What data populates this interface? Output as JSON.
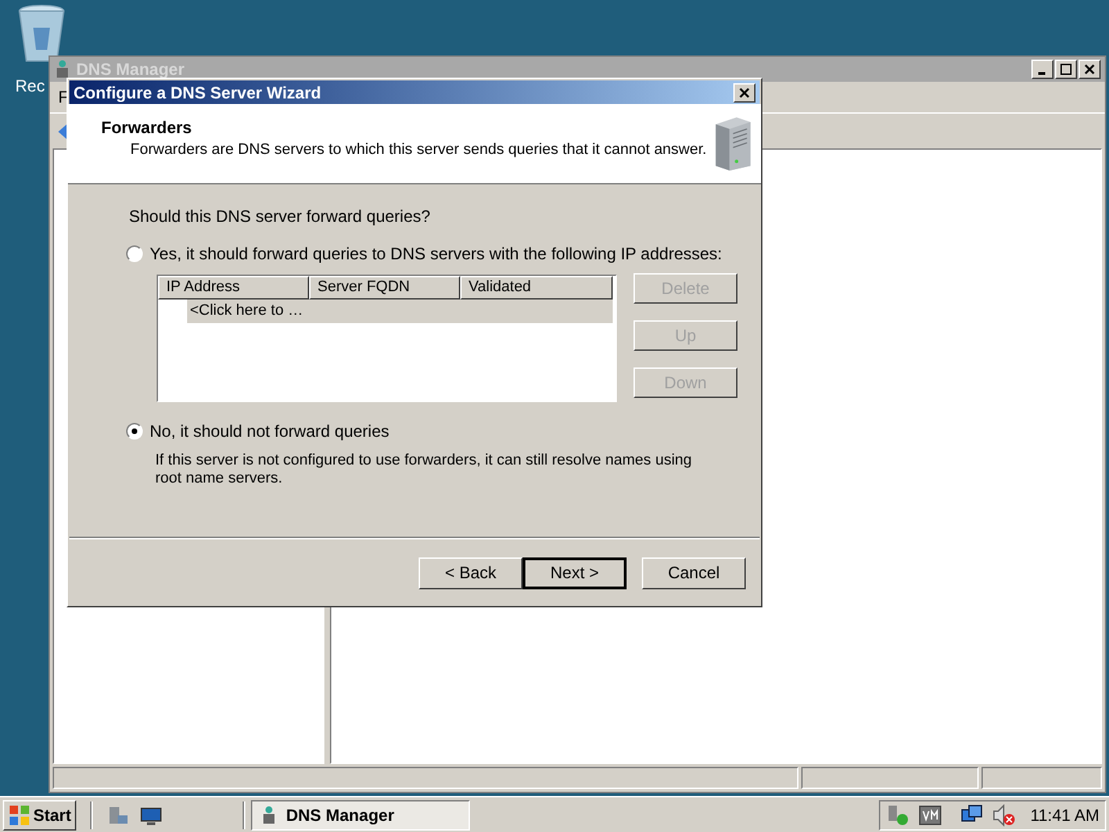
{
  "desktop": {
    "icons": [
      {
        "label": "Rec"
      }
    ]
  },
  "main_window": {
    "title": "DNS Manager",
    "menu": [
      "F"
    ]
  },
  "wizard": {
    "title": "Configure a DNS Server Wizard",
    "header": {
      "title": "Forwarders",
      "description": "Forwarders are DNS servers to which this server sends queries that it cannot answer."
    },
    "question": "Should this DNS server forward queries?",
    "options": [
      {
        "label": "Yes, it should forward queries to DNS servers with the following IP addresses:",
        "selected": false
      },
      {
        "label": "No, it should not forward queries",
        "selected": true
      }
    ],
    "table": {
      "columns": [
        "IP Address",
        "Server FQDN",
        "Validated"
      ],
      "new_row": "<Click here to …"
    },
    "side_buttons": [
      {
        "label": "Delete",
        "disabled": true
      },
      {
        "label": "Up",
        "disabled": true
      },
      {
        "label": "Down",
        "disabled": true
      }
    ],
    "note": "If this server is not configured to use forwarders, it can still resolve names using root name servers.",
    "buttons": [
      {
        "label": "< Back",
        "default": false
      },
      {
        "label": "Next >",
        "default": true
      },
      {
        "label": "Cancel",
        "default": false
      }
    ]
  },
  "taskbar": {
    "start": "Start",
    "tasks": [
      {
        "label": "DNS Manager",
        "selected": true
      }
    ],
    "clock": "11:41 AM"
  }
}
